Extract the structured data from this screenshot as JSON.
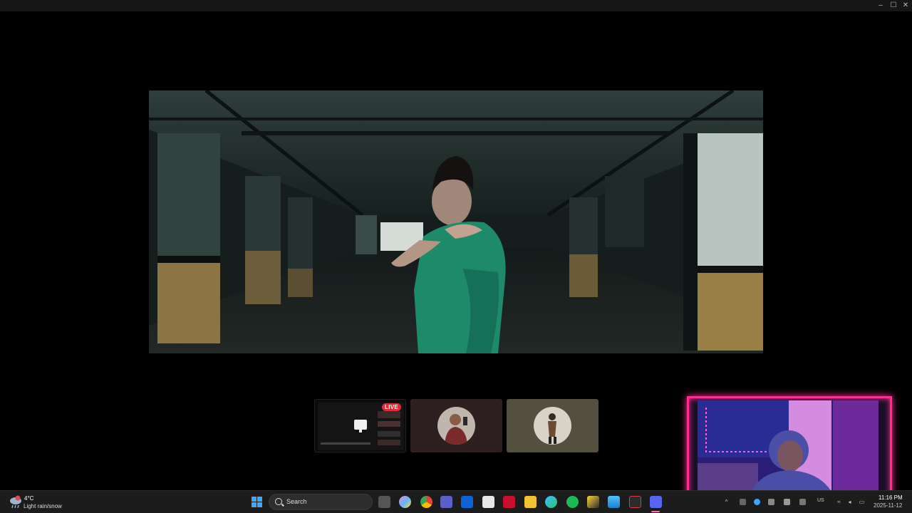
{
  "window": {
    "minimize": "–",
    "maximize": "☐",
    "close": "✕"
  },
  "tiles": {
    "screen_share": {
      "badge": "LIVE",
      "icon": "monitor-icon"
    },
    "participant_1": {
      "icon": "avatar"
    },
    "participant_2": {
      "icon": "avatar"
    }
  },
  "taskbar": {
    "weather": {
      "temp": "4°C",
      "desc": "Light rain/snow",
      "icon": "rain-snow-icon"
    },
    "search": {
      "placeholder": "Search"
    },
    "apps": [
      "windows-start-icon",
      "task-view-icon",
      "copilot-icon",
      "chrome-icon",
      "teams-icon",
      "outlook-icon",
      "store-icon",
      "mcafee-icon",
      "file-explorer-icon",
      "edge-icon",
      "spotify-icon",
      "adobe-icon",
      "photos-icon",
      "acrobat-icon",
      "discord-icon"
    ],
    "tray": {
      "lang": "US"
    },
    "clock": {
      "time": "11:16 PM",
      "date": "2025-11-12"
    }
  },
  "colors": {
    "facecam_border": "#ff2d8f",
    "live_badge": "#e02a3a",
    "shirt": "#1f8a6a"
  }
}
